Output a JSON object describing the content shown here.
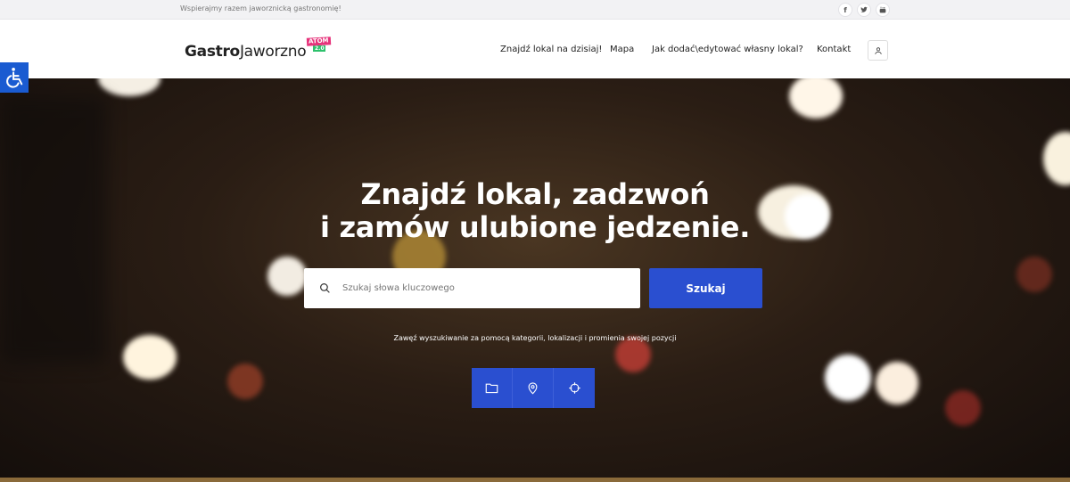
{
  "topbar": {
    "tagline": "Wspierajmy razem jaworznicką gastronomię!",
    "social": [
      {
        "icon": "facebook-icon",
        "glyph": "f"
      },
      {
        "icon": "twitter-icon",
        "glyph": "🐦"
      },
      {
        "icon": "youtube-icon",
        "glyph": "▶"
      }
    ]
  },
  "header": {
    "logo_bold": "Gastro",
    "logo_light": "Jaworzno",
    "badge_top": "ATOM",
    "badge_bottom": "2.0",
    "nav": [
      {
        "label": "Znajdź lokal na dzisiaj!"
      },
      {
        "label": "Mapa"
      },
      {
        "label": "Jak dodać\\edytować własny lokal?"
      },
      {
        "label": "Kontakt"
      }
    ]
  },
  "hero": {
    "title_line1": "Znajdź lokal, zadzwoń",
    "title_line2": "i zamów ulubione jedzenie.",
    "search_placeholder": "Szukaj słowa kluczowego",
    "search_button": "Szukaj",
    "hint": "Zawęź wyszukiwanie za pomocą kategorii, lokalizacji i promienia swojej pozycji",
    "filters": [
      {
        "icon": "folder-icon"
      },
      {
        "icon": "map-pin-icon"
      },
      {
        "icon": "crosshair-icon"
      }
    ]
  },
  "colors": {
    "accent": "#2a4fd0",
    "badge_pink": "#e6327a",
    "badge_green": "#2ec16c",
    "a11y_blue": "#1a5bd1"
  }
}
